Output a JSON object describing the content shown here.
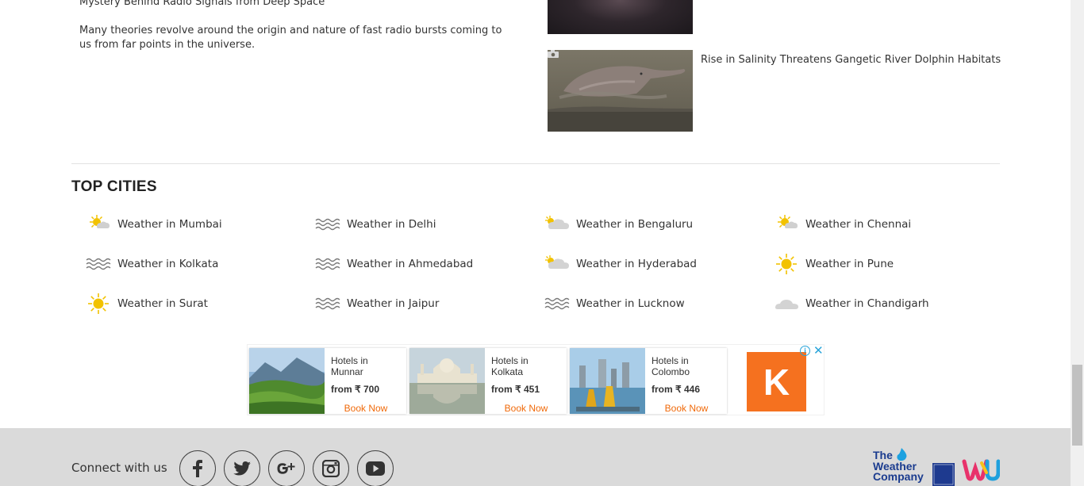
{
  "article_left": {
    "title": "Mystery Behind Radio Signals from Deep Space",
    "summary": "Many theories revolve around the origin and nature of fast radio bursts coming to us from far points in the universe."
  },
  "article_right": {
    "caption": "Rise in Salinity Threatens Gangetic River Dolphin Habitats"
  },
  "top_cities": {
    "title": "TOP CITIES",
    "cities": [
      {
        "label": "Weather in Mumbai",
        "icon": "partly-sunny-icon"
      },
      {
        "label": "Weather in Delhi",
        "icon": "haze-icon"
      },
      {
        "label": "Weather in Bengaluru",
        "icon": "partly-cloudy-icon"
      },
      {
        "label": "Weather in Chennai",
        "icon": "partly-sunny-icon"
      },
      {
        "label": "Weather in Kolkata",
        "icon": "haze-icon"
      },
      {
        "label": "Weather in Ahmedabad",
        "icon": "haze-icon"
      },
      {
        "label": "Weather in Hyderabad",
        "icon": "partly-cloudy-icon"
      },
      {
        "label": "Weather in Pune",
        "icon": "sunny-icon"
      },
      {
        "label": "Weather in Surat",
        "icon": "sunny-icon"
      },
      {
        "label": "Weather in Jaipur",
        "icon": "haze-icon"
      },
      {
        "label": "Weather in Lucknow",
        "icon": "haze-icon"
      },
      {
        "label": "Weather in Chandigarh",
        "icon": "cloudy-icon"
      }
    ]
  },
  "ad": {
    "cards": [
      {
        "title": "Hotels in Munnar",
        "price": "from ₹ 700",
        "cta": "Book Now"
      },
      {
        "title": "Hotels in Kolkata",
        "price": "from ₹ 451",
        "cta": "Book Now"
      },
      {
        "title": "Hotels in Colombo",
        "price": "from ₹ 446",
        "cta": "Book Now"
      }
    ],
    "logo_letter": "K",
    "info_glyph": "i",
    "close_glyph": "✕"
  },
  "footer": {
    "connect_label": "Connect with us",
    "social": [
      "facebook-icon",
      "twitter-icon",
      "google-plus-icon",
      "instagram-icon",
      "youtube-icon"
    ],
    "brand_text": [
      "The",
      "Weather",
      "Company"
    ]
  },
  "colors": {
    "sun": "#f2c200",
    "cloud": "#cfcfcf",
    "haze": "#7a7a7a",
    "cta": "#f06a0a",
    "kayak": "#f5711f",
    "footer_bg": "#dadada"
  }
}
